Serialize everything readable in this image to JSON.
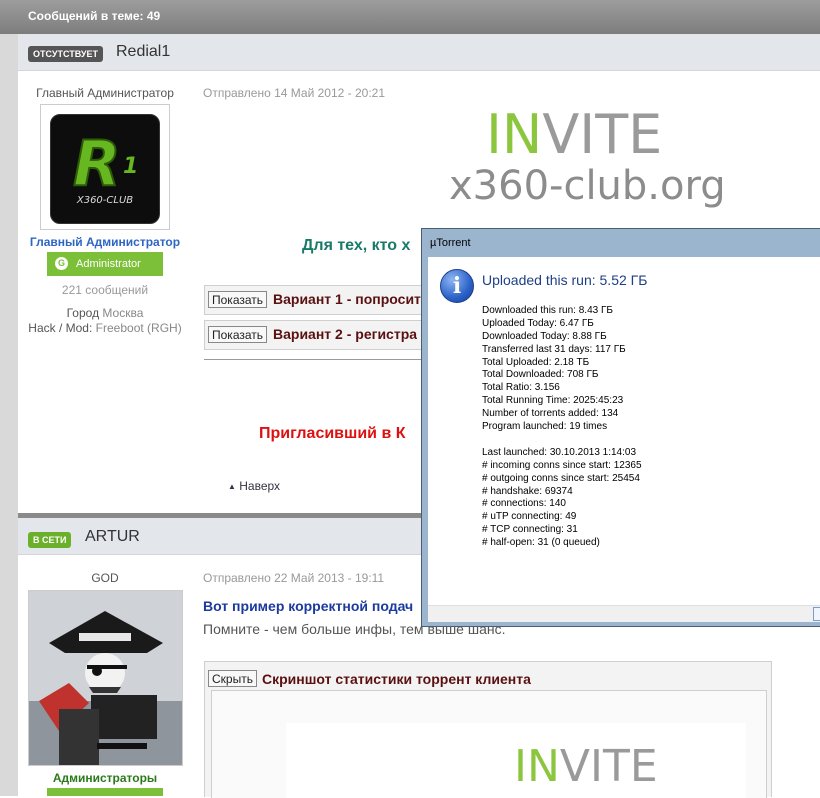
{
  "topic_bar": {
    "title": "Сообщений в теме: 49"
  },
  "post1": {
    "status": "ОТСУТСТВУЕТ",
    "author": "Redial1",
    "user_title": "Главный Администратор",
    "avatar_text": "X360-CLUB",
    "group_name": "Главный Администратор",
    "group_badge": "Administrator",
    "group_badge_letter": "G",
    "posts_count": "221 сообщений",
    "city_label": "Город",
    "city": "Москва",
    "hack_label": "Hack / Mod:",
    "hack": "Freeboot (RGH)",
    "posted": "Отправлено 14 Май 2012 - 20:21",
    "invite_in": "IN",
    "invite_vite": "VITE",
    "invite_domain": "x360-club.org",
    "green_line": "Для тех, кто х",
    "spoilers": [
      {
        "button": "Показать",
        "title": "Вариант 1 - попросит"
      },
      {
        "button": "Показать",
        "title": "Вариант 2 - регистра"
      }
    ],
    "red_line": "Пригласивший в К",
    "top_link": "Наверх"
  },
  "post2": {
    "status": "В СЕТИ",
    "author": "ARTUR",
    "user_title": "GOD",
    "group_name": "Администраторы",
    "posted": "Отправлено 22 Май 2013 - 19:11",
    "line1": "Вот пример корректной подач",
    "line2": "Помните - чем больше инфы, тем выше шанс.",
    "spoiler": {
      "button": "Скрыть",
      "title": "Скриншот статистики торрент клиента"
    },
    "invite_in": "IN",
    "invite_vite": "VITE"
  },
  "utorrent": {
    "window_title": "µTorrent",
    "headline": "Uploaded this run: 5.52 ГБ",
    "stats_a": [
      "Downloaded this run: 8.43 ГБ",
      "Uploaded Today: 6.47 ГБ",
      "Downloaded Today: 8.88 ГБ",
      "Transferred last 31 days: 117 ГБ",
      "Total Uploaded: 2.18 ТБ",
      "Total Downloaded: 708 ГБ",
      "Total Ratio: 3.156",
      "Total Running Time: 2025:45:23",
      "Number of torrents added: 134",
      "Program launched: 19 times"
    ],
    "stats_b": [
      "Last launched: 30.10.2013 1:14:03",
      "# incoming conns since start: 12365",
      "# outgoing conns since start: 25454",
      "# handshake: 69374",
      "# connections: 140",
      "# uTP connecting: 49",
      "# TCP connecting: 31",
      "# half-open: 31 (0 queued)"
    ]
  },
  "colors": {
    "accent_green": "#8cc63f",
    "link_blue": "#2d66c4",
    "badge_green": "#7cc03a"
  }
}
